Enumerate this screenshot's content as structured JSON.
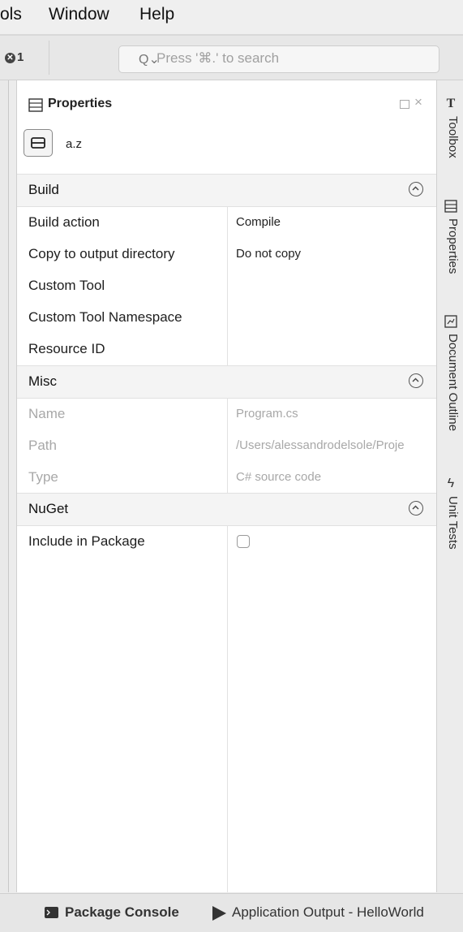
{
  "menubar": {
    "items": [
      {
        "label": "ols"
      },
      {
        "label": "Window"
      },
      {
        "label": "Help"
      }
    ]
  },
  "toolbar": {
    "error_count": "1",
    "search_placeholder": "Press '⌘.' to search"
  },
  "properties_panel": {
    "title": "Properties",
    "object_name": "a.z",
    "sections": [
      {
        "label": "Build",
        "rows": [
          {
            "name": "Build action",
            "value": "Compile"
          },
          {
            "name": "Copy to output directory",
            "value": "Do not copy"
          },
          {
            "name": "Custom Tool",
            "value": ""
          },
          {
            "name": "Custom Tool Namespace",
            "value": ""
          },
          {
            "name": "Resource ID",
            "value": ""
          }
        ]
      },
      {
        "label": "Misc",
        "rows": [
          {
            "name": "Name",
            "value": "Program.cs"
          },
          {
            "name": "Path",
            "value": "/Users/alessandrodelsole/Proje"
          },
          {
            "name": "Type",
            "value": "C# source code"
          }
        ]
      },
      {
        "label": "NuGet",
        "rows": [
          {
            "name": "Include in Package",
            "value": "",
            "checked": false
          }
        ]
      }
    ]
  },
  "sidebar": {
    "tabs": [
      {
        "label": "Toolbox",
        "icon": "toolbox-icon"
      },
      {
        "label": "Properties",
        "icon": "properties-icon"
      },
      {
        "label": "Document Outline",
        "icon": "document-outline-icon"
      },
      {
        "label": "Unit Tests",
        "icon": "unit-tests-icon"
      }
    ]
  },
  "statusbar": {
    "package_console": "Package Console",
    "application_output": "Application Output - HelloWorld"
  }
}
